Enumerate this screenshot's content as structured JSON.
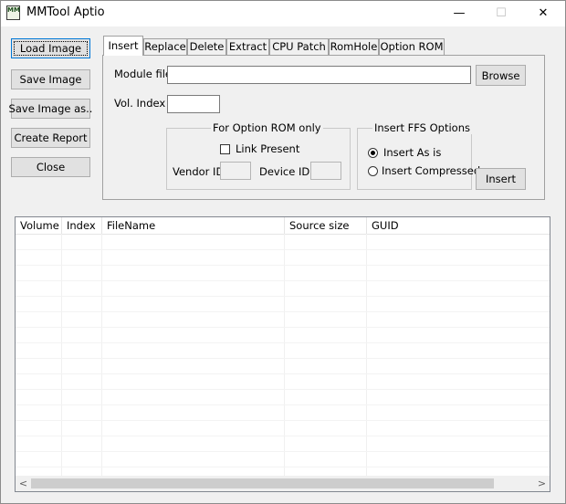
{
  "window": {
    "title": "MMTool Aptio",
    "icon_text": "MM",
    "controls": {
      "minimize": "—",
      "maximize": "☐",
      "close": "✕"
    }
  },
  "left_buttons": {
    "load_image": "Load Image",
    "save_image": "Save Image",
    "save_image_as": "Save Image as..",
    "create_report": "Create Report",
    "close": "Close"
  },
  "tabs": [
    "Insert",
    "Replace",
    "Delete",
    "Extract",
    "CPU Patch",
    "RomHole",
    "Option ROM"
  ],
  "active_tab": "Insert",
  "insert_panel": {
    "module_file_label": "Module file",
    "module_file_value": "",
    "browse_button": "Browse",
    "vol_index_label": "Vol. Index",
    "vol_index_value": "",
    "option_rom_group": {
      "title": "For Option ROM only",
      "link_present_label": "Link Present",
      "link_present_checked": false,
      "vendor_id_label": "Vendor ID",
      "vendor_id_value": "",
      "device_id_label": "Device ID",
      "device_id_value": ""
    },
    "ffs_group": {
      "title": "Insert FFS Options",
      "options": [
        "Insert As is",
        "Insert Compressed"
      ],
      "selected": "Insert As is"
    },
    "insert_button": "Insert"
  },
  "table": {
    "columns": [
      "Volume",
      "Index",
      "FileName",
      "Source size",
      "GUID"
    ],
    "rows": []
  },
  "scrollbar": {
    "left_arrow": "<",
    "right_arrow": ">"
  }
}
